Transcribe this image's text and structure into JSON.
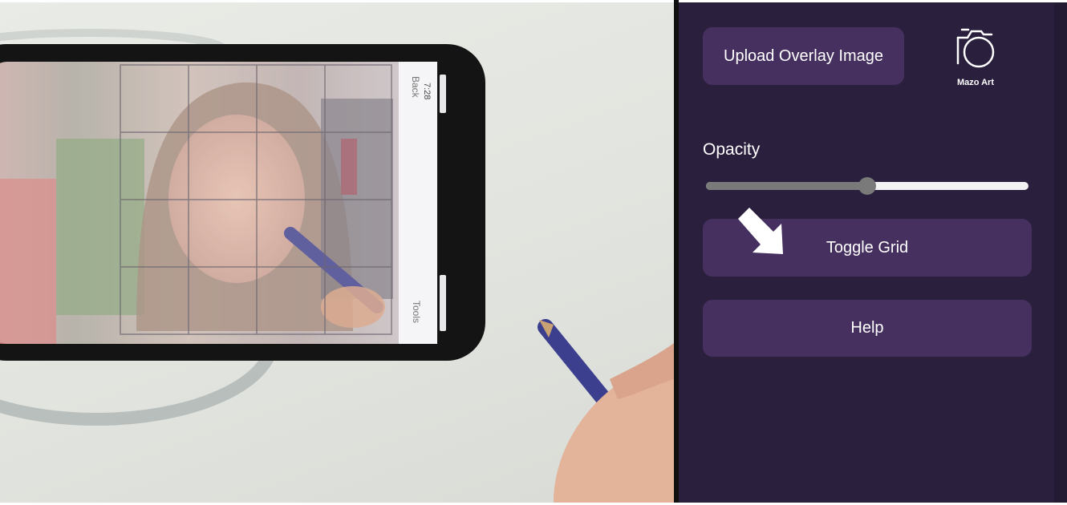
{
  "panel": {
    "upload_button_label": "Upload Overlay Image",
    "logo_text": "Mazo Art",
    "logo_icon": "camera-icon",
    "opacity_label": "Opacity",
    "opacity_value": 0.5,
    "toggle_grid_label": "Toggle Grid",
    "help_label": "Help",
    "arrow_icon": "pointer-arrow-icon"
  },
  "phone_screen": {
    "time": "7:28",
    "back_label": "Back",
    "tools_label": "Tools"
  },
  "colors": {
    "panel_bg": "#2b1f3e",
    "button_bg": "#46305f",
    "text": "#ffffff",
    "slider_fill": "#7a7a7a",
    "slider_track": "#f2f2f2"
  }
}
